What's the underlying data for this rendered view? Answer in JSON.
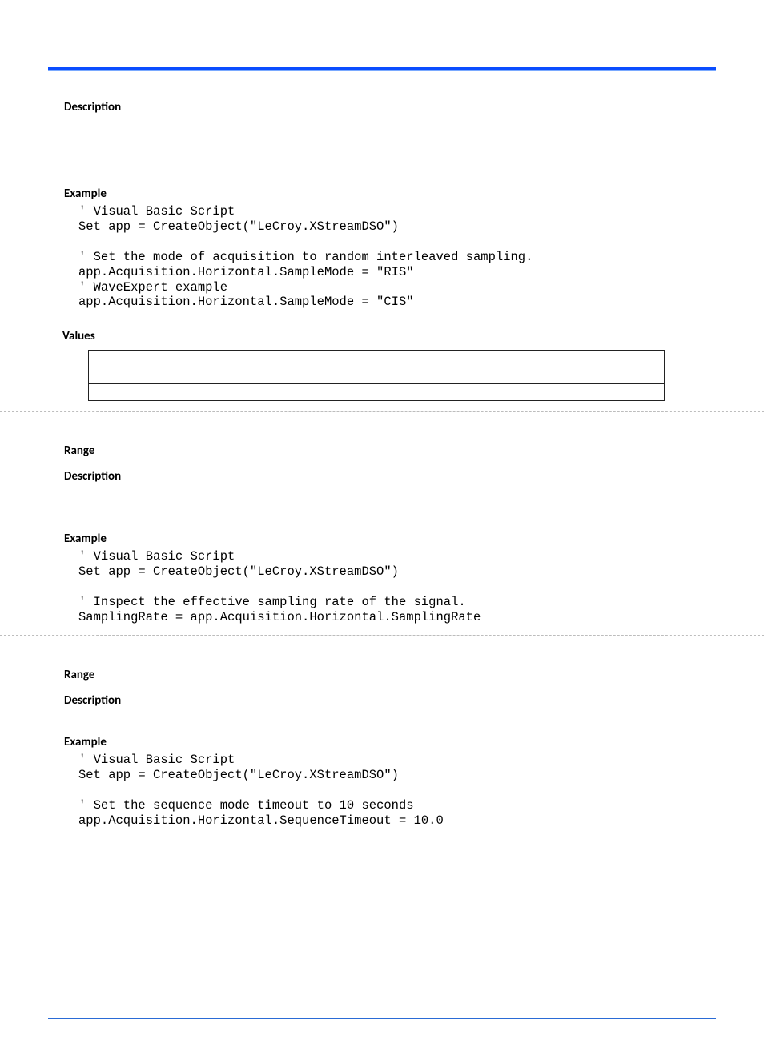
{
  "headings": {
    "description": "Description",
    "example": "Example",
    "values": "Values",
    "range": "Range"
  },
  "blocks": [
    {
      "kind": "desc-only"
    },
    {
      "kind": "example",
      "code": "' Visual Basic Script\nSet app = CreateObject(\"LeCroy.XStreamDSO\")\n\n' Set the mode of acquisition to random interleaved sampling.\napp.Acquisition.Horizontal.SampleMode = \"RIS\"\n' WaveExpert example\napp.Acquisition.Horizontal.SampleMode = \"CIS\""
    },
    {
      "kind": "values-table",
      "rows": [
        [
          "",
          ""
        ],
        [
          "",
          ""
        ],
        [
          "",
          ""
        ]
      ]
    },
    {
      "kind": "range-desc-example",
      "code": "' Visual Basic Script\nSet app = CreateObject(\"LeCroy.XStreamDSO\")\n\n' Inspect the effective sampling rate of the signal.\nSamplingRate = app.Acquisition.Horizontal.SamplingRate"
    },
    {
      "kind": "range-desc-example",
      "code": "' Visual Basic Script\nSet app = CreateObject(\"LeCroy.XStreamDSO\")\n\n' Set the sequence mode timeout to 10 seconds\napp.Acquisition.Horizontal.SequenceTimeout = 10.0"
    }
  ]
}
